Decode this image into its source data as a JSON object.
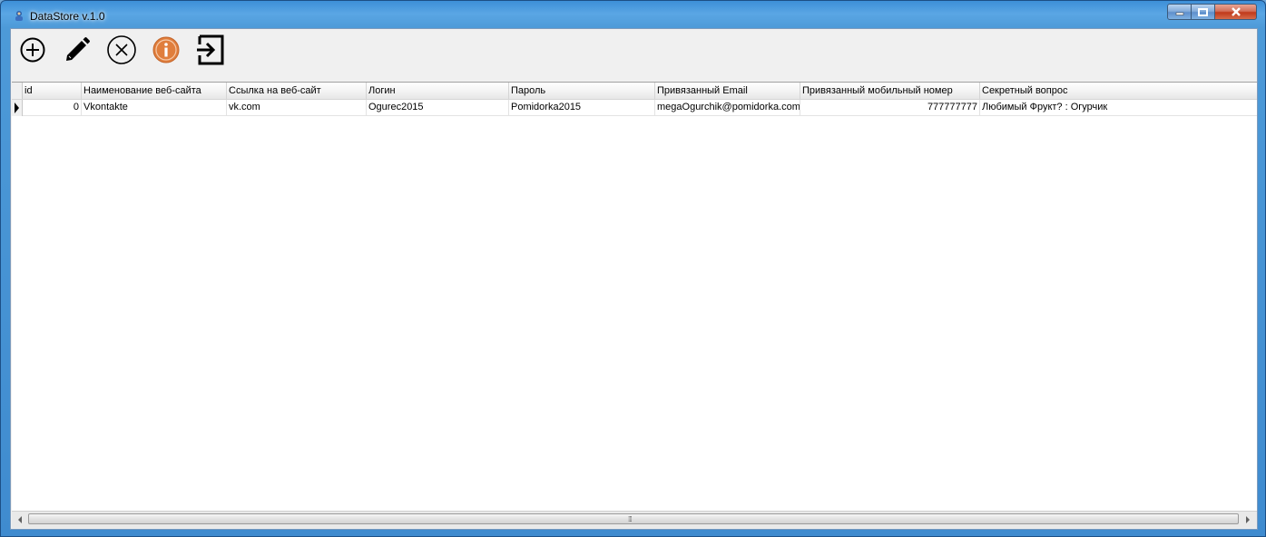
{
  "window": {
    "title": "DataStore v.1.0"
  },
  "toolbar": {
    "buttons": [
      {
        "icon": "add-circle-icon"
      },
      {
        "icon": "pencil-icon"
      },
      {
        "icon": "cancel-circle-icon"
      },
      {
        "icon": "info-icon",
        "color": "#e07e3c"
      },
      {
        "icon": "exit-icon"
      }
    ]
  },
  "grid": {
    "columns": [
      "id",
      "Наименование веб-сайта",
      "Ссылка на веб-сайт",
      "Логин",
      "Пароль",
      "Привязанный Email",
      "Привязанный мобильный номер",
      "Секретный вопрос"
    ],
    "rows": [
      [
        "0",
        "Vkontakte",
        "vk.com",
        "Ogurec2015",
        "Pomidorka2015",
        "megaOgurchik@pomidorka.com",
        "777777777",
        "Любимый Фрукт? : Огурчик"
      ]
    ]
  },
  "scrollbar": {
    "grip": "⁞⁞⁞"
  }
}
